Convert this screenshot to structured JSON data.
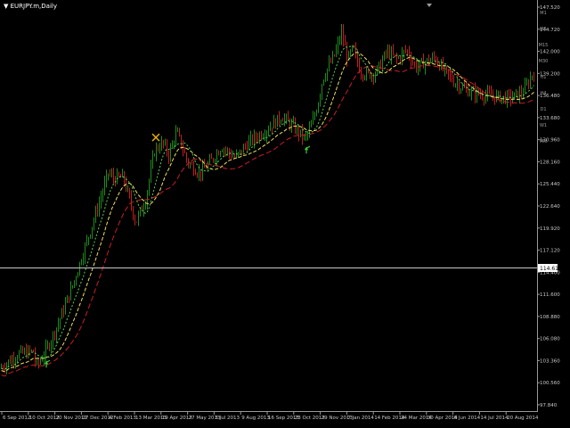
{
  "chart": {
    "symbol_label": "▼ EURJPY.m,Daily",
    "background": "#000000",
    "candle_up_color": "#1e8c1e",
    "candle_down_color": "#c0201e",
    "fast_ma_color": "#5ad05a",
    "mid_ma_color": "#f0e060",
    "slow_ma_color": "#c81e28",
    "crosshair_color": "#c8c8c8",
    "buy_arrow_color": "#3cc83c",
    "sell_cross_color": "#e8b000",
    "timeframes": [
      "M1",
      "M5",
      "M15",
      "M30",
      "H1",
      "H4",
      "D1",
      "W1",
      "MN"
    ],
    "crosshair_price": "114.614"
  },
  "chart_data": {
    "type": "candlestick",
    "x_tick_labels": [
      "6 Sep 2012",
      "10 Oct 2012",
      "20 Nov 2012",
      "27 Dec 2012",
      "4 Feb 2013",
      "13 Mar 2013",
      "19 Apr 2013",
      "27 May 2013",
      "3 Jul 2013",
      "9 Aug 2013",
      "16 Sep 2013",
      "23 Oct 2013",
      "29 Nov 2013",
      "7 Jan 2014",
      "14 Feb 2014",
      "24 Mar 2014",
      "30 Apr 2014",
      "6 Jun 2014",
      "14 Jul 2014",
      "20 Aug 2014"
    ],
    "y_tick_labels": [
      "147.520",
      "144.720",
      "142.000",
      "139.200",
      "136.480",
      "133.680",
      "130.960",
      "128.160",
      "125.440",
      "122.640",
      "119.920",
      "117.120",
      "114.400",
      "111.600",
      "108.880",
      "106.080",
      "103.360",
      "100.560",
      "97.840"
    ],
    "ylim": [
      96.2,
      148.4
    ],
    "price_path_x": [
      0,
      20,
      37,
      40,
      46,
      55,
      66,
      82,
      97,
      112,
      121,
      128,
      138,
      152,
      163,
      173,
      182,
      189,
      198,
      210,
      224,
      236,
      248,
      264,
      278,
      294,
      306,
      316,
      330,
      342,
      350,
      356,
      362,
      368,
      375,
      383,
      390,
      396,
      404,
      412,
      422,
      434,
      446,
      456,
      466,
      478,
      488,
      498,
      510,
      522,
      534,
      546,
      556,
      566,
      576,
      584,
      590,
      596,
      600
    ],
    "price_path_y": [
      100.8,
      102.7,
      103.0,
      101.0,
      102.0,
      104.0,
      107.0,
      112.0,
      117.5,
      123.0,
      126.5,
      125.8,
      126.0,
      120.0,
      123.0,
      129.5,
      130.5,
      129.0,
      132.0,
      128.0,
      126.5,
      128.0,
      130.0,
      128.5,
      130.5,
      131.8,
      133.0,
      134.0,
      132.5,
      131.0,
      133.0,
      135.5,
      139.0,
      140.5,
      142.0,
      145.0,
      141.5,
      143.0,
      140.0,
      139.5,
      139.8,
      142.5,
      141.5,
      142.8,
      140.5,
      141.2,
      141.8,
      140.0,
      138.5,
      137.5,
      137.0,
      136.8,
      136.6,
      136.4,
      136.6,
      137.0,
      137.8,
      139.3,
      140.2
    ],
    "buy_signal_x": [
      54,
      346
    ],
    "sell_signal_x": [
      175
    ],
    "moving_averages": [
      "fast",
      "mid",
      "slow"
    ]
  }
}
